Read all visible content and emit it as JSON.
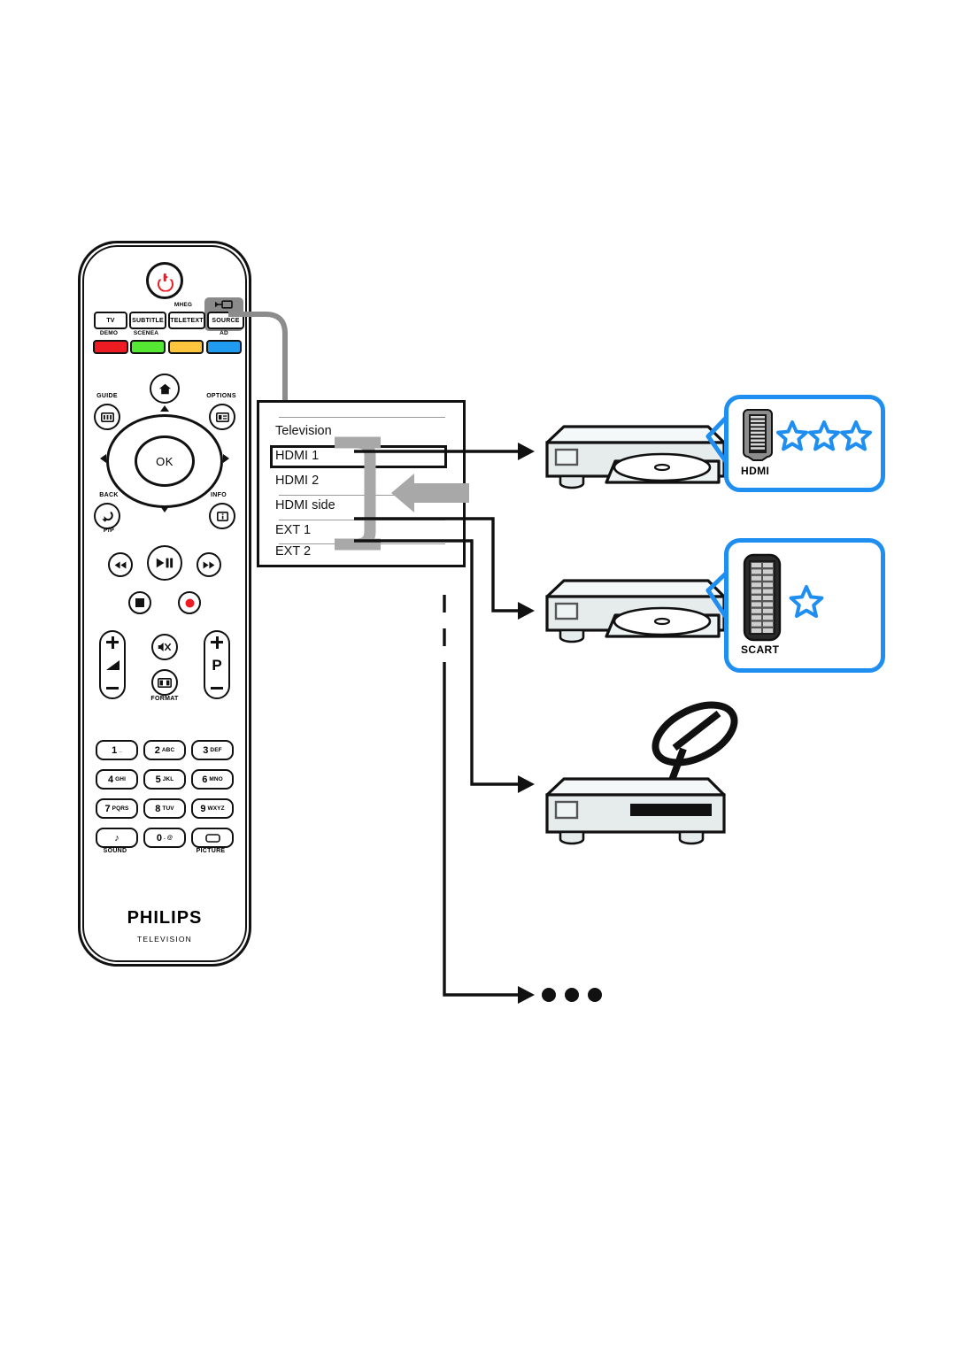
{
  "remote": {
    "brand": "PHILIPS",
    "brand_sub": "TELEVISION",
    "power_icon": "power-icon",
    "top_buttons": [
      {
        "label": "TV",
        "name": "tv-button"
      },
      {
        "label": "SUBTITLE",
        "name": "subtitle-button"
      },
      {
        "label": "TELETEXT",
        "name": "teletext-button"
      },
      {
        "label": "SOURCE",
        "name": "source-button"
      }
    ],
    "top_over_labels": [
      {
        "label": "MHEG",
        "name": "mheg-label"
      }
    ],
    "source_icon": "source-input-icon",
    "color_labels": [
      {
        "label": "DEMO",
        "name": "demo-label"
      },
      {
        "label": "SCENEA",
        "name": "scenea-label"
      },
      {
        "label": "AD",
        "name": "ad-label"
      }
    ],
    "colors": {
      "red": "#ed1c24",
      "green": "#55e832",
      "yellow": "#ffc53d",
      "blue": "#1f9cf0",
      "accent": "#1f8ef1",
      "source_key_bg": "#8a8a8a",
      "device_body": "#e6ecec",
      "grey_line": "#8c8c8c"
    },
    "nav": {
      "home_icon": "home-icon",
      "ok_label": "OK",
      "guide_label": "GUIDE",
      "guide_icon": "guide-icon",
      "options_label": "OPTIONS",
      "options_icon": "options-icon",
      "back_label": "BACK",
      "back_sub_label": "P/P",
      "back_icon": "back-arrow-icon",
      "info_label": "INFO",
      "info_icon": "info-icon",
      "up_icon": "chevron-up-icon",
      "down_icon": "chevron-down-icon",
      "left_icon": "chevron-left-icon",
      "right_icon": "chevron-right-icon"
    },
    "transport": {
      "rewind_icon": "rewind-icon",
      "playpause_icon": "play-pause-icon",
      "fastforward_icon": "fast-forward-icon",
      "stop_icon": "stop-icon",
      "record_icon": "record-icon"
    },
    "rockers": {
      "volume_icon": "volume-icon",
      "volume_plus": "plus-icon",
      "volume_minus": "minus-icon",
      "mute_icon": "mute-icon",
      "format_icon": "format-icon",
      "format_label": "FORMAT",
      "program_label": "P",
      "program_plus": "plus-icon",
      "program_minus": "minus-icon"
    },
    "keypad": [
      {
        "big": "1",
        "small": "_",
        "name": "key-1"
      },
      {
        "big": "2",
        "small": "ABC",
        "name": "key-2"
      },
      {
        "big": "3",
        "small": "DEF",
        "name": "key-3"
      },
      {
        "big": "4",
        "small": "GHI",
        "name": "key-4"
      },
      {
        "big": "5",
        "small": "JKL",
        "name": "key-5"
      },
      {
        "big": "6",
        "small": "MNO",
        "name": "key-6"
      },
      {
        "big": "7",
        "small": "PQRS",
        "name": "key-7"
      },
      {
        "big": "8",
        "small": "TUV",
        "name": "key-8"
      },
      {
        "big": "9",
        "small": "WXYZ",
        "name": "key-9"
      },
      {
        "big": "♪",
        "small": "",
        "name": "key-sound"
      },
      {
        "big": "0",
        "small": ". @",
        "name": "key-0"
      },
      {
        "big": "",
        "small": "",
        "name": "key-picture"
      }
    ],
    "keypad_labels": [
      {
        "label": "SOUND",
        "name": "sound-label"
      },
      {
        "label": "PICTURE",
        "name": "picture-label"
      }
    ]
  },
  "menu": {
    "title": "Television",
    "items": [
      "Television",
      "HDMI 1",
      "HDMI 2",
      "HDMI side",
      "EXT 1",
      "EXT 2"
    ],
    "selected": "HDMI 1",
    "selected_index": 1
  },
  "callouts": [
    {
      "name": "hdmi-callout",
      "label": "HDMI",
      "connector": "hdmi-connector-icon",
      "stars": 3
    },
    {
      "name": "scart-callout",
      "label": "SCART",
      "connector": "scart-connector-icon",
      "stars": 1
    }
  ],
  "devices": [
    {
      "name": "disc-player-top",
      "type": "disc-player"
    },
    {
      "name": "disc-player-middle",
      "type": "disc-player"
    },
    {
      "name": "satellite-receiver",
      "type": "satellite-receiver"
    }
  ],
  "ellipsis": {
    "dots": 3,
    "name": "more-devices-ellipsis"
  }
}
